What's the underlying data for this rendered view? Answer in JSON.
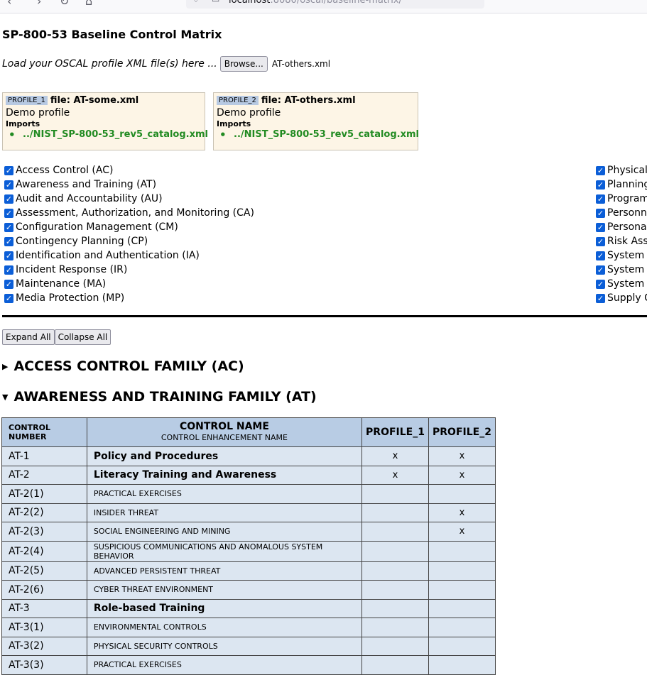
{
  "browser": {
    "url_host": "localhost",
    "url_path": ":8080/oscal/baseline-matrix/"
  },
  "page": {
    "title": "SP-800-53 Baseline Control Matrix",
    "load_prompt": "Load your OSCAL profile XML file(s) here ...",
    "browse_label": "Browse...",
    "selected_file": "AT-others.xml"
  },
  "profiles": [
    {
      "tag": "PROFILE_1",
      "file_label": "file: AT-some.xml",
      "description": "Demo profile",
      "imports_label": "Imports",
      "import_href": "../NIST_SP-800-53_rev5_catalog.xml"
    },
    {
      "tag": "PROFILE_2",
      "file_label": "file: AT-others.xml",
      "description": "Demo profile",
      "imports_label": "Imports",
      "import_href": "../NIST_SP-800-53_rev5_catalog.xml"
    }
  ],
  "families_left": [
    {
      "label": "Access Control (AC)",
      "checked": true
    },
    {
      "label": "Awareness and Training (AT)",
      "checked": true
    },
    {
      "label": "Audit and Accountability (AU)",
      "checked": true
    },
    {
      "label": "Assessment, Authorization, and Monitoring (CA)",
      "checked": true
    },
    {
      "label": "Configuration Management (CM)",
      "checked": true
    },
    {
      "label": "Contingency Planning (CP)",
      "checked": true
    },
    {
      "label": "Identification and Authentication (IA)",
      "checked": true
    },
    {
      "label": "Incident Response (IR)",
      "checked": true
    },
    {
      "label": "Maintenance (MA)",
      "checked": true
    },
    {
      "label": "Media Protection (MP)",
      "checked": true
    }
  ],
  "families_right": [
    {
      "label": "Physical",
      "checked": true
    },
    {
      "label": "Planning",
      "checked": true
    },
    {
      "label": "Program",
      "checked": true
    },
    {
      "label": "Personne",
      "checked": true
    },
    {
      "label": "Personal",
      "checked": true
    },
    {
      "label": "Risk Asse",
      "checked": true
    },
    {
      "label": "System a",
      "checked": true
    },
    {
      "label": "System a",
      "checked": true
    },
    {
      "label": "System a",
      "checked": true
    },
    {
      "label": "Supply C",
      "checked": true
    }
  ],
  "buttons": {
    "expand_all": "Expand All",
    "collapse_all": "Collapse All"
  },
  "sections": [
    {
      "heading": "ACCESS CONTROL FAMILY (AC)",
      "expanded": false
    },
    {
      "heading": "AWARENESS AND TRAINING FAMILY (AT)",
      "expanded": true
    }
  ],
  "table": {
    "headers": {
      "number": "CONTROL NUMBER",
      "name": "CONTROL NAME",
      "name_sub": "CONTROL ENHANCEMENT NAME",
      "profile_1": "PROFILE_1",
      "profile_2": "PROFILE_2"
    },
    "rows": [
      {
        "num": "AT-1",
        "name": "Policy and Procedures",
        "type": "base",
        "p1": "x",
        "p2": "x"
      },
      {
        "num": "AT-2",
        "name": "Literacy Training and Awareness",
        "type": "base",
        "p1": "x",
        "p2": "x"
      },
      {
        "num": "AT-2(1)",
        "name": "PRACTICAL EXERCISES",
        "type": "enh",
        "p1": "",
        "p2": ""
      },
      {
        "num": "AT-2(2)",
        "name": "INSIDER THREAT",
        "type": "enh",
        "p1": "",
        "p2": "x"
      },
      {
        "num": "AT-2(3)",
        "name": "SOCIAL ENGINEERING AND MINING",
        "type": "enh",
        "p1": "",
        "p2": "x"
      },
      {
        "num": "AT-2(4)",
        "name": "SUSPICIOUS COMMUNICATIONS AND ANOMALOUS SYSTEM BEHAVIOR",
        "type": "enh",
        "p1": "",
        "p2": ""
      },
      {
        "num": "AT-2(5)",
        "name": "ADVANCED PERSISTENT THREAT",
        "type": "enh",
        "p1": "",
        "p2": ""
      },
      {
        "num": "AT-2(6)",
        "name": "CYBER THREAT ENVIRONMENT",
        "type": "enh",
        "p1": "",
        "p2": ""
      },
      {
        "num": "AT-3",
        "name": "Role-based Training",
        "type": "base",
        "p1": "",
        "p2": ""
      },
      {
        "num": "AT-3(1)",
        "name": "ENVIRONMENTAL CONTROLS",
        "type": "enh",
        "p1": "",
        "p2": ""
      },
      {
        "num": "AT-3(2)",
        "name": "PHYSICAL SECURITY CONTROLS",
        "type": "enh",
        "p1": "",
        "p2": ""
      },
      {
        "num": "AT-3(3)",
        "name": "PRACTICAL EXERCISES",
        "type": "enh",
        "p1": "",
        "p2": ""
      }
    ]
  },
  "colors": {
    "header_bg": "#b8cce4",
    "cell_bg": "#dce6f1",
    "profile_bg": "#fdf5e6",
    "link_green": "#228b22",
    "checkbox_blue": "#0b5ed7"
  }
}
